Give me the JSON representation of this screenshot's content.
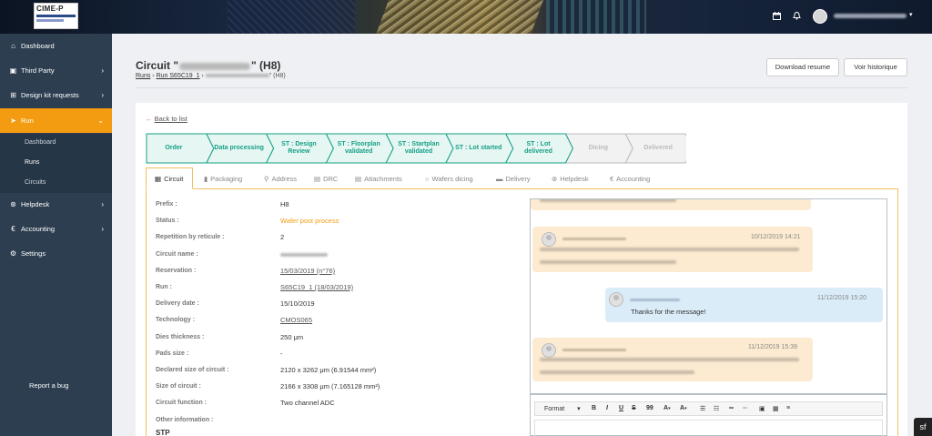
{
  "topbar": {
    "logo_text": "CIME-P",
    "calendar_icon": "calendar-icon",
    "bell_icon": "bell-icon",
    "user_caret": "▾"
  },
  "sidebar": {
    "items": [
      {
        "label": "Dashboard",
        "icon": "home-icon"
      },
      {
        "label": "Third Party",
        "icon": "book-icon"
      },
      {
        "label": "Design kit requests",
        "icon": "sitemap-icon"
      },
      {
        "label": "Run",
        "icon": "paper-plane-icon"
      },
      {
        "label": "Helpdesk",
        "icon": "lifebuoy-icon"
      },
      {
        "label": "Accounting",
        "icon": "euro-icon"
      },
      {
        "label": "Settings",
        "icon": "gears-icon"
      }
    ],
    "run_subitems": [
      "Dashboard",
      "Runs",
      "Circuits"
    ],
    "report_bug": "Report a bug"
  },
  "header": {
    "title_prefix": "Circuit \"",
    "title_suffix": "\" (H8)",
    "breadcrumb_runs": "Runs",
    "breadcrumb_sep": "›",
    "breadcrumb_run": "Run S65C19_1",
    "breadcrumb_tail": "\" (H8)",
    "download_button": "Download resume",
    "history_button": "Voir historique"
  },
  "back_link": "Back to list",
  "steps": [
    {
      "label": "Order",
      "state": "done"
    },
    {
      "label": "Data processing",
      "state": "done"
    },
    {
      "label": "ST : Design Review",
      "state": "done"
    },
    {
      "label": "ST : Floorplan validated",
      "state": "done"
    },
    {
      "label": "ST : Startplan validated",
      "state": "done"
    },
    {
      "label": "ST : Lot started",
      "state": "done"
    },
    {
      "label": "ST : Lot delivered",
      "state": "done"
    },
    {
      "label": "Dicing",
      "state": "todo"
    },
    {
      "label": "Delivered",
      "state": "todo"
    }
  ],
  "tabs": [
    {
      "label": "Circuit",
      "icon": "circuit-icon"
    },
    {
      "label": "Packaging",
      "icon": "file-icon"
    },
    {
      "label": "Address",
      "icon": "map-marker-icon"
    },
    {
      "label": "DRC",
      "icon": "calendar-icon"
    },
    {
      "label": "Attachments",
      "icon": "attachment-icon"
    },
    {
      "label": "Wafers dicing",
      "icon": "circle-icon"
    },
    {
      "label": "Delivery",
      "icon": "truck-icon"
    },
    {
      "label": "Helpdesk",
      "icon": "lifebuoy-icon"
    },
    {
      "label": "Accounting",
      "icon": "euro-icon"
    }
  ],
  "fields": [
    {
      "label": "Prefix :",
      "value": "H8",
      "style": "plain"
    },
    {
      "label": "Status :",
      "value": "Wafer post process",
      "style": "orange"
    },
    {
      "label": "Repetition by reticule :",
      "value": "2",
      "style": "plain"
    },
    {
      "label": "Circuit name :",
      "value": "",
      "style": "blur"
    },
    {
      "label": "Reservation :",
      "value": "15/03/2019 (n°76)",
      "style": "link"
    },
    {
      "label": "Run :",
      "value": "S65C19_1 (18/03/2019)",
      "style": "link"
    },
    {
      "label": "Delivery date :",
      "value": "15/10/2019",
      "style": "plain"
    },
    {
      "label": "Technology :",
      "value": "CMOS065",
      "style": "link"
    },
    {
      "label": "Dies thickness :",
      "value": "250 μm",
      "style": "plain"
    },
    {
      "label": "Pads size :",
      "value": "-",
      "style": "plain"
    },
    {
      "label": "Declared size of circuit :",
      "value": "2120 x 3262 μm (6.91544 mm²)",
      "style": "plain"
    },
    {
      "label": "Size of circuit :",
      "value": "2166 x 3308 μm (7.165128 mm²)",
      "style": "plain"
    },
    {
      "label": "Circuit function :",
      "value": "Two channel ADC",
      "style": "plain"
    },
    {
      "label": "Other information :",
      "value": "",
      "style": "plain"
    }
  ],
  "section_heading_partial": "STP",
  "chat": {
    "messages": [
      {
        "side": "in",
        "time": "10/12/2019 14:21",
        "text": ""
      },
      {
        "side": "out",
        "time": "11/12/2019 15:20",
        "text": "Thanks for the message!"
      },
      {
        "side": "in",
        "time": "11/12/2019 15:39",
        "text": ""
      }
    ]
  },
  "editor": {
    "format_label": "Format",
    "tools": [
      "B",
      "I",
      "U",
      "S",
      "99",
      "A",
      "A",
      "list-icon",
      "numbered-list-icon",
      "link-icon",
      "unlink-icon",
      "image-icon",
      "table-icon",
      "hr-icon"
    ]
  },
  "symfony_badge": "sf"
}
